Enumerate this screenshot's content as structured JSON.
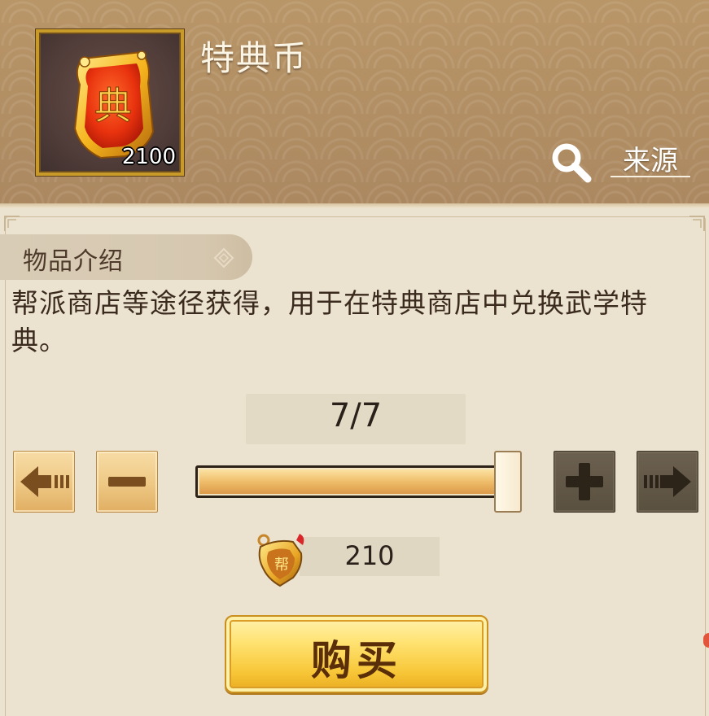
{
  "item": {
    "name": "特典币",
    "count": "2100",
    "icon": "tedian-coin-icon",
    "token_char": "典"
  },
  "header": {
    "source_label": "来源",
    "search_icon": "magnifier-icon"
  },
  "description_section": {
    "title": "物品介绍",
    "text": "帮派商店等途径获得，用于在特典商店中兑换武学特典。"
  },
  "quantity": {
    "current": 7,
    "max": 7,
    "display": "7/7",
    "slider_fraction": 1.0
  },
  "controls": {
    "min_button_icon": "arrow-left-end-icon",
    "minus_button_icon": "minus-icon",
    "plus_button_icon": "plus-icon",
    "max_button_icon": "arrow-right-end-icon"
  },
  "price": {
    "currency_icon": "bangpai-coin-icon",
    "value": "210"
  },
  "buy_button": {
    "label": "购买"
  },
  "colors": {
    "header_bg": "#b18d64",
    "panel_bg": "#ebe3d0",
    "button_gold": "#f7c637",
    "button_dark": "#5a5040"
  }
}
